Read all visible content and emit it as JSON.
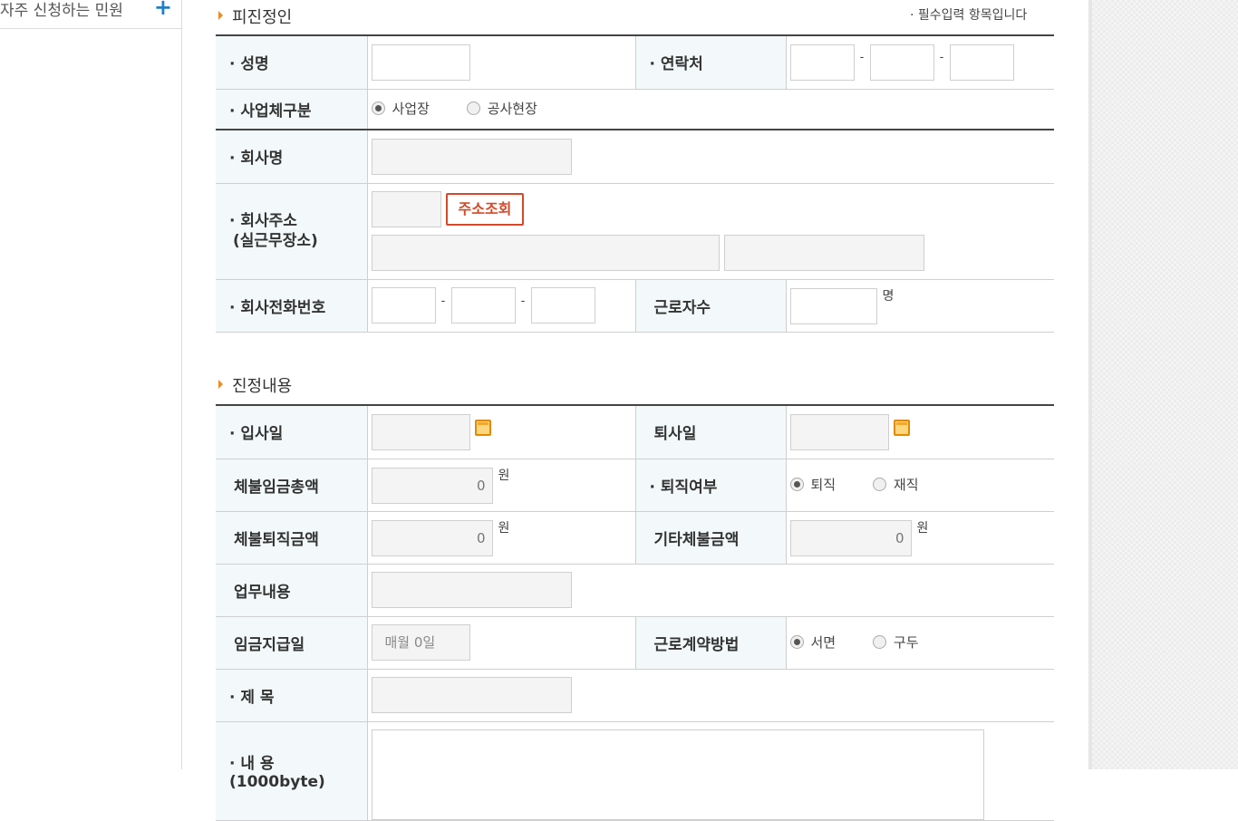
{
  "sidebar": {
    "item_label": "자주 신청하는 민원",
    "plus": "+"
  },
  "section1": {
    "title": "피진정인",
    "required_note": "· 필수입력 항목입니다",
    "name_label": "· 성명",
    "contact_label": "· 연락처",
    "biz_type_label": "· 사업체구분",
    "biz_type_options": [
      "사업장",
      "공사현장"
    ],
    "company_label": "· 회사명",
    "address_label_1": "· 회사주소",
    "address_label_2": "(실근무장소)",
    "address_button": "주소조회",
    "phone_label": "· 회사전화번호",
    "workers_label": "근로자수",
    "workers_unit": "명",
    "dash": "-"
  },
  "section2": {
    "title": "진정내용",
    "join_label": "· 입사일",
    "leave_label": "퇴사일",
    "unpaid_total_label": "체불임금총액",
    "unpaid_total_value": "0",
    "retired_label": "· 퇴직여부",
    "retired_options": [
      "퇴직",
      "재직"
    ],
    "unpaid_severance_label": "체불퇴직금액",
    "unpaid_severance_value": "0",
    "other_unpaid_label": "기타체불금액",
    "other_unpaid_value": "0",
    "won": "원",
    "duty_label": "업무내용",
    "payday_label": "임금지급일",
    "payday_placeholder": "매월 0일",
    "contract_label": "근로계약방법",
    "contract_options": [
      "서면",
      "구두"
    ],
    "subject_label": "· 제 목",
    "content_label": "· 내 용(1000byte)"
  }
}
